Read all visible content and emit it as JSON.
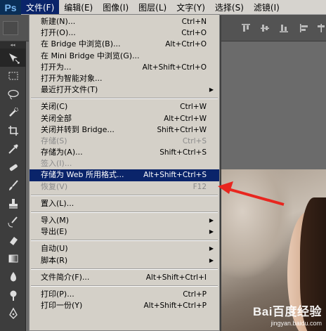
{
  "app": {
    "logo": "Ps"
  },
  "menubar": [
    {
      "name": "menu-file",
      "label": "文件(F)",
      "active": true
    },
    {
      "name": "menu-edit",
      "label": "编辑(E)",
      "active": false
    },
    {
      "name": "menu-image",
      "label": "图像(I)",
      "active": false
    },
    {
      "name": "menu-layer",
      "label": "图层(L)",
      "active": false
    },
    {
      "name": "menu-type",
      "label": "文字(Y)",
      "active": false
    },
    {
      "name": "menu-select",
      "label": "选择(S)",
      "active": false
    },
    {
      "name": "menu-filter",
      "label": "滤镜(I)",
      "active": false
    }
  ],
  "file_menu": {
    "groups": [
      [
        {
          "label": "新建(N)...",
          "shortcut": "Ctrl+N",
          "disabled": false
        },
        {
          "label": "打开(O)...",
          "shortcut": "Ctrl+O",
          "disabled": false
        },
        {
          "label": "在 Bridge 中浏览(B)...",
          "shortcut": "Alt+Ctrl+O",
          "disabled": false
        },
        {
          "label": "在 Mini Bridge 中浏览(G)...",
          "shortcut": "",
          "disabled": false
        },
        {
          "label": "打开为...",
          "shortcut": "Alt+Shift+Ctrl+O",
          "disabled": false
        },
        {
          "label": "打开为智能对象...",
          "shortcut": "",
          "disabled": false
        },
        {
          "label": "最近打开文件(T)",
          "shortcut": "",
          "disabled": false,
          "submenu": true
        }
      ],
      [
        {
          "label": "关闭(C)",
          "shortcut": "Ctrl+W",
          "disabled": false
        },
        {
          "label": "关闭全部",
          "shortcut": "Alt+Ctrl+W",
          "disabled": false
        },
        {
          "label": "关闭并转到 Bridge...",
          "shortcut": "Shift+Ctrl+W",
          "disabled": false
        },
        {
          "label": "存储(S)",
          "shortcut": "Ctrl+S",
          "disabled": true
        },
        {
          "label": "存储为(A)...",
          "shortcut": "Shift+Ctrl+S",
          "disabled": false
        },
        {
          "label": "签入(I)...",
          "shortcut": "",
          "disabled": true
        },
        {
          "label": "存储为 Web 所用格式...",
          "shortcut": "Alt+Shift+Ctrl+S",
          "disabled": false,
          "highlight": true
        },
        {
          "label": "恢复(V)",
          "shortcut": "F12",
          "disabled": true
        }
      ],
      [
        {
          "label": "置入(L)...",
          "shortcut": "",
          "disabled": false
        }
      ],
      [
        {
          "label": "导入(M)",
          "shortcut": "",
          "disabled": false,
          "submenu": true
        },
        {
          "label": "导出(E)",
          "shortcut": "",
          "disabled": false,
          "submenu": true
        }
      ],
      [
        {
          "label": "自动(U)",
          "shortcut": "",
          "disabled": false,
          "submenu": true
        },
        {
          "label": "脚本(R)",
          "shortcut": "",
          "disabled": false,
          "submenu": true
        }
      ],
      [
        {
          "label": "文件简介(F)...",
          "shortcut": "Alt+Shift+Ctrl+I",
          "disabled": false
        }
      ],
      [
        {
          "label": "打印(P)...",
          "shortcut": "Ctrl+P",
          "disabled": false
        },
        {
          "label": "打印一份(Y)",
          "shortcut": "Alt+Shift+Ctrl+P",
          "disabled": false
        }
      ]
    ]
  },
  "tools": [
    "move-tool-icon",
    "marquee-tool-icon",
    "lasso-tool-icon",
    "quick-select-tool-icon",
    "crop-tool-icon",
    "eyedropper-tool-icon",
    "healing-brush-tool-icon",
    "brush-tool-icon",
    "clone-stamp-tool-icon",
    "history-brush-tool-icon",
    "eraser-tool-icon",
    "gradient-tool-icon",
    "blur-tool-icon",
    "dodge-tool-icon",
    "pen-tool-icon"
  ],
  "watermark": {
    "main": "Bai百度经验",
    "sub": "jingyan.baidu.com"
  },
  "colors": {
    "menu_bg": "#d4d0c8",
    "highlight": "#0a246a",
    "arrow": "#e8261f",
    "logo_bg": "#0a2f57"
  }
}
